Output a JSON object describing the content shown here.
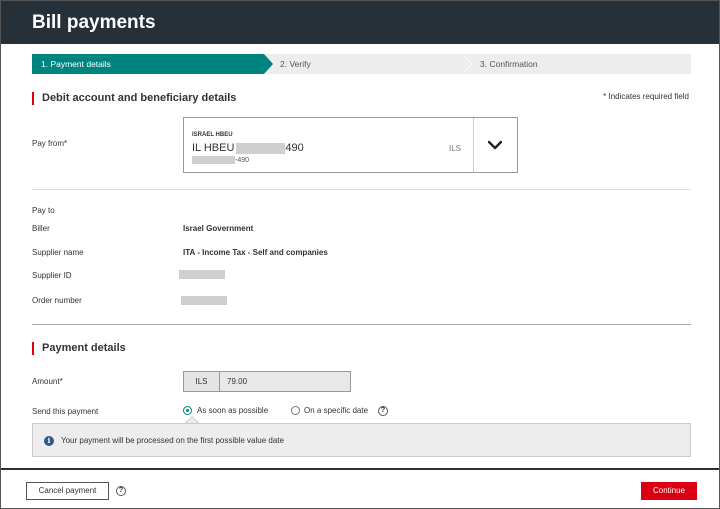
{
  "window": {
    "title": "Bill payments"
  },
  "stepper": {
    "steps": [
      {
        "label": "1. Payment details"
      },
      {
        "label": "2. Verify"
      },
      {
        "label": "3. Confirmation"
      }
    ]
  },
  "debit_section": {
    "title": "Debit account and beneficiary details",
    "required_note": "* Indicates required field",
    "pay_from_label": "Pay from*",
    "account": {
      "bank": "ISRAEL HBEU",
      "number_prefix": "IL HBEU",
      "number_suffix": "490",
      "sub_suffix": "-490",
      "currency": "ILS"
    }
  },
  "pay_to": {
    "heading": "Pay to",
    "biller_label": "Biller",
    "biller_value": "Israel Government",
    "supplier_name_label": "Supplier name",
    "supplier_name_value": "ITA - Income Tax - Self and companies",
    "supplier_id_label": "Supplier ID",
    "order_number_label": "Order number"
  },
  "payment_section": {
    "title": "Payment details",
    "amount_label": "Amount*",
    "amount_currency": "ILS",
    "amount_value": "79.00",
    "send_label": "Send this payment",
    "option_asap": "As soon as possible",
    "option_specific": "On a specific date",
    "selected_option": "As soon as possible",
    "info_text": "Your payment will be processed on the first possible value date"
  },
  "footer": {
    "cancel_label": "Cancel payment",
    "continue_label": "Continue"
  },
  "colors": {
    "header_bg": "#253038",
    "accent_teal": "#00847f",
    "accent_red": "#db0011"
  }
}
